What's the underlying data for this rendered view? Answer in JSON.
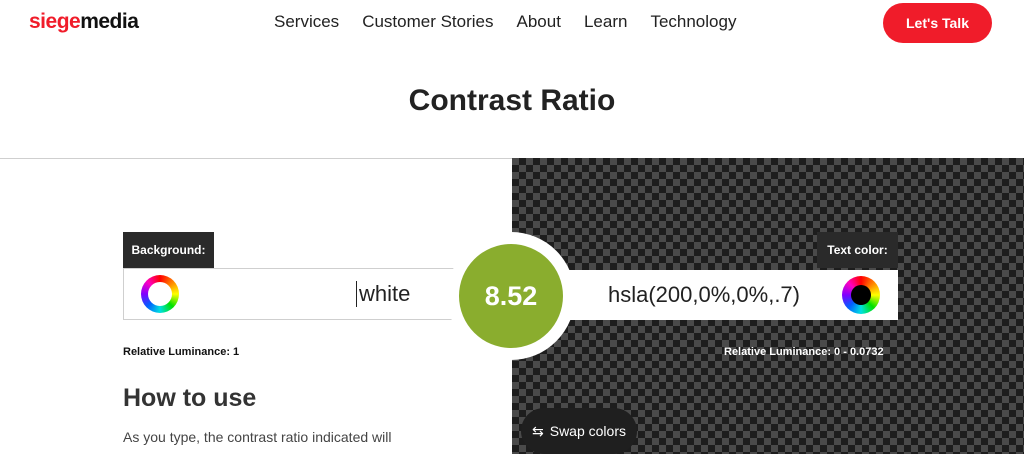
{
  "header": {
    "logo_part1": "siege",
    "logo_part2": "media",
    "nav": [
      "Services",
      "Customer Stories",
      "About",
      "Learn",
      "Technology"
    ],
    "cta_label": "Let's Talk"
  },
  "page_title": "Contrast Ratio",
  "background": {
    "label": "Background:",
    "value": "white",
    "luminance_label": "Relative Luminance:",
    "luminance_value": "1"
  },
  "text_color": {
    "label": "Text color:",
    "value": "hsla(200,0%,0%,.7)",
    "luminance_label": "Relative Luminance:",
    "luminance_value": "0 - 0.0732"
  },
  "ratio": "8.52",
  "swap_label": "Swap colors",
  "how_to": {
    "title": "How to use",
    "line1": "As you type, the contrast ratio indicated will"
  },
  "colors": {
    "brand_red": "#f01c2a",
    "ratio_green": "#8aad2e",
    "dark_label": "#2a2a2a"
  }
}
